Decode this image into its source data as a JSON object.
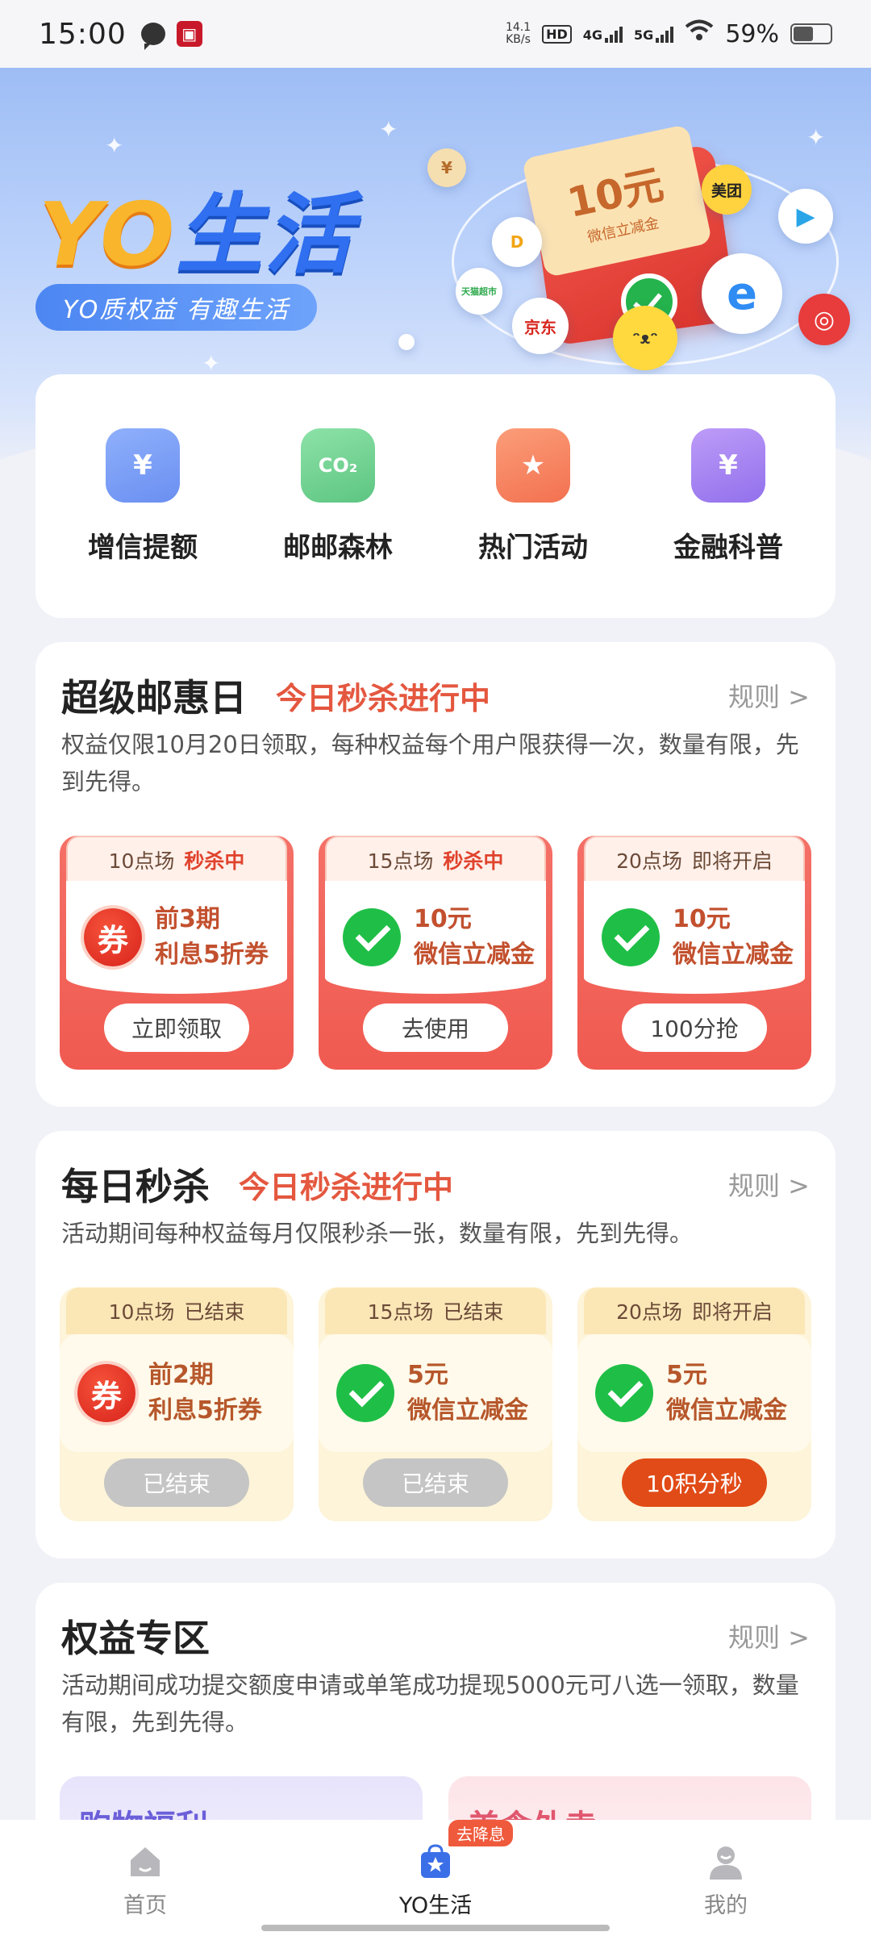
{
  "status_bar": {
    "time": "15:00",
    "speed": "14.1",
    "speed_unit": "KB/s",
    "hd": "HD",
    "net1": "4G",
    "net2": "5G",
    "battery": "59%"
  },
  "hero": {
    "title_yo": "YO",
    "title_cn": "生活",
    "slogan": "YO质权益 有趣生活",
    "coupon_value": "10元",
    "coupon_desc": "微信立减金",
    "brand_meituan": "美团",
    "brand_jd": "京东",
    "brand_tmall": "天猫超市"
  },
  "quick_entries": [
    {
      "label": "增信提额",
      "icon": "credit-wallet-icon",
      "color": "#7a9cf5"
    },
    {
      "label": "邮邮森林",
      "icon": "co2-cloud-icon",
      "color": "#6ccf8f"
    },
    {
      "label": "热门活动",
      "icon": "bookmark-star-icon",
      "color": "#f6845e"
    },
    {
      "label": "金融科普",
      "icon": "finance-search-icon",
      "color": "#a57ef0"
    }
  ],
  "super_day": {
    "title": "超级邮惠日",
    "subtitle": "今日秒杀进行中",
    "rule": "规则 >",
    "desc": "权益仅限10月20日领取，每种权益每个用户限获得一次，数量有限，先到先得。",
    "coupons": [
      {
        "session": "10点场",
        "status": "秒杀中",
        "line1": "前3期",
        "line2": "利息5折券",
        "button": "立即领取"
      },
      {
        "session": "15点场",
        "status": "秒杀中",
        "line1": "10元",
        "line2": "微信立减金",
        "button": "去使用"
      },
      {
        "session": "20点场",
        "status": "即将开启",
        "line1": "10元",
        "line2": "微信立减金",
        "button": "100分抢"
      }
    ]
  },
  "daily_kill": {
    "title": "每日秒杀",
    "subtitle": "今日秒杀进行中",
    "rule": "规则 >",
    "desc": "活动期间每种权益每月仅限秒杀一张，数量有限，先到先得。",
    "coupons": [
      {
        "session": "10点场",
        "status": "已结束",
        "line1": "前2期",
        "line2": "利息5折券",
        "button": "已结束"
      },
      {
        "session": "15点场",
        "status": "已结束",
        "line1": "5元",
        "line2": "微信立减金",
        "button": "已结束"
      },
      {
        "session": "20点场",
        "status": "即将开启",
        "line1": "5元",
        "line2": "微信立减金",
        "button": "10积分秒"
      }
    ]
  },
  "benefits": {
    "title": "权益专区",
    "rule": "规则 >",
    "desc": "活动期间成功提交额度申请或单笔成功提现5000元可八选一领取，数量有限，先到先得。",
    "tab1": "购物福利",
    "tab2": "美食外卖"
  },
  "coupon_icon_char": "券",
  "bottom_nav": {
    "home": "首页",
    "yo": "YO生活",
    "me": "我的",
    "badge": "去降息"
  },
  "colors": {
    "accent": "#e4573f",
    "primary": "#2f6ff0",
    "coupon_red": "#f05a50"
  }
}
